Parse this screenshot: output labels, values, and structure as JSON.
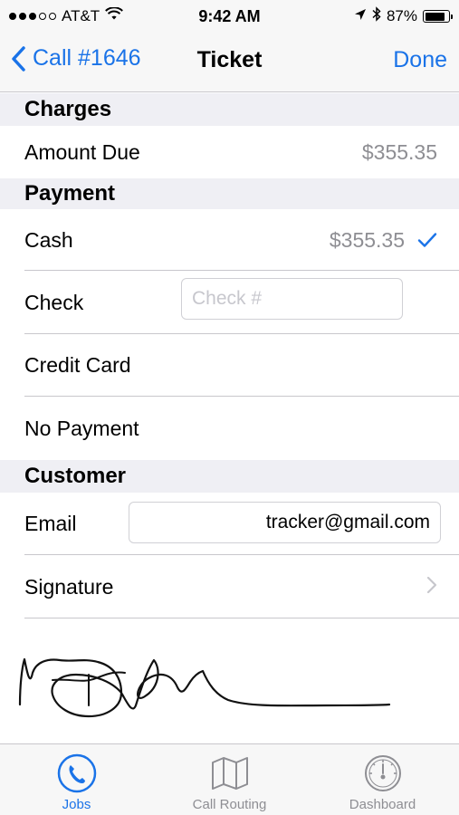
{
  "status_bar": {
    "carrier": "AT&T",
    "time": "9:42 AM",
    "battery": "87%",
    "battery_level": 0.87,
    "signal_bars_filled": 3,
    "signal_bars_total": 5
  },
  "nav": {
    "back_label": "Call #1646",
    "title": "Ticket",
    "done_label": "Done"
  },
  "sections": {
    "charges": "Charges",
    "payment": "Payment",
    "customer": "Customer"
  },
  "charges": {
    "amount_due_label": "Amount Due",
    "amount_due_value": "$355.35"
  },
  "payment": {
    "cash_label": "Cash",
    "cash_value": "$355.35",
    "cash_selected": true,
    "check_label": "Check",
    "check_placeholder": "Check #",
    "check_value": "",
    "credit_card_label": "Credit Card",
    "no_payment_label": "No Payment"
  },
  "customer": {
    "email_label": "Email",
    "email_value": "tracker@gmail.com",
    "signature_label": "Signature"
  },
  "tabs": [
    {
      "label": "Jobs",
      "icon": "phone-icon",
      "active": true
    },
    {
      "label": "Call Routing",
      "icon": "map-icon",
      "active": false
    },
    {
      "label": "Dashboard",
      "icon": "gauge-icon",
      "active": false
    }
  ],
  "colors": {
    "accent": "#1a73e8",
    "section_bg": "#efeff4",
    "secondary_text": "#8e8e93"
  }
}
